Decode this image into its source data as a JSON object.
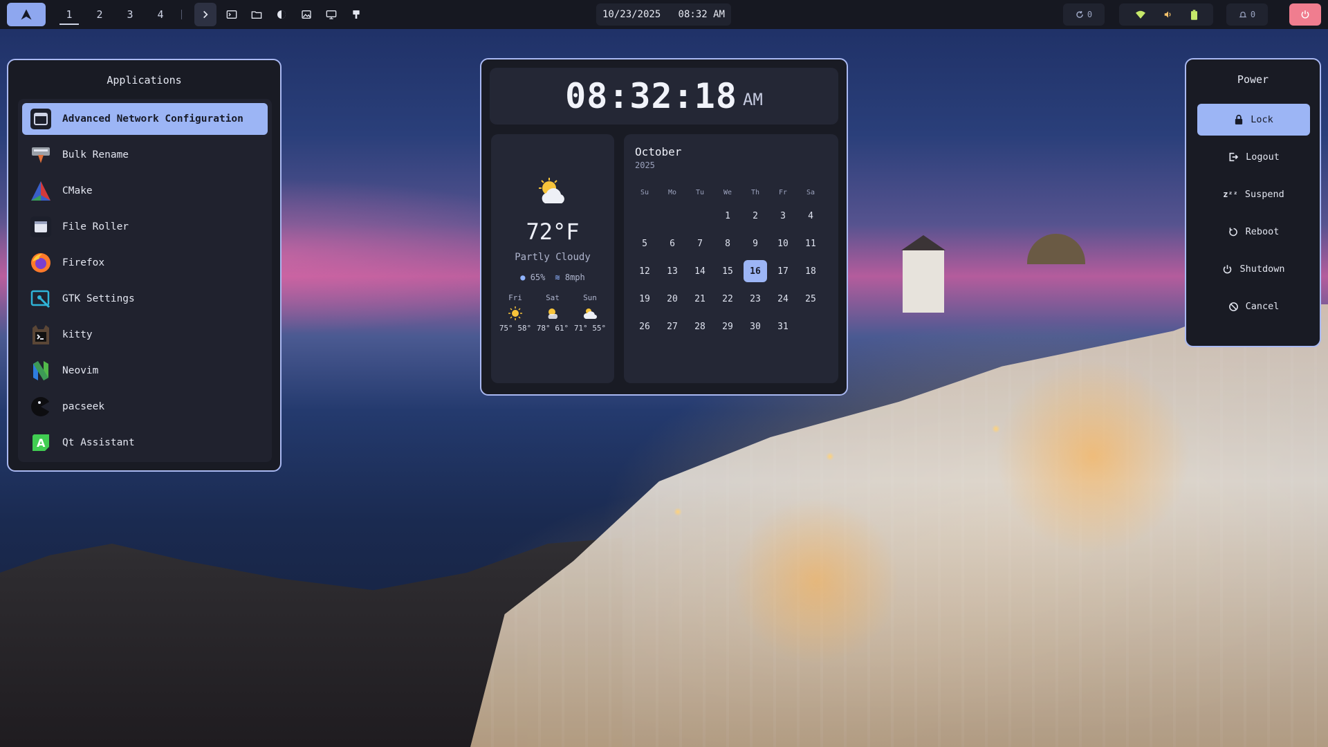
{
  "topbar": {
    "workspaces": [
      "1",
      "2",
      "3",
      "4"
    ],
    "active_workspace": "1",
    "datetime": "10/23/2025   08:32 AM",
    "updates_count": "0",
    "notifications_count": "0"
  },
  "applications": {
    "title": "Applications",
    "items": [
      {
        "label": "Advanced Network Configuration",
        "icon": "network-config-icon"
      },
      {
        "label": "Bulk Rename",
        "icon": "bulk-rename-icon"
      },
      {
        "label": "CMake",
        "icon": "cmake-icon"
      },
      {
        "label": "File Roller",
        "icon": "file-roller-icon"
      },
      {
        "label": "Firefox",
        "icon": "firefox-icon"
      },
      {
        "label": "GTK Settings",
        "icon": "gtk-settings-icon"
      },
      {
        "label": "kitty",
        "icon": "kitty-icon"
      },
      {
        "label": "Neovim",
        "icon": "neovim-icon"
      },
      {
        "label": "pacseek",
        "icon": "pacseek-icon"
      },
      {
        "label": "Qt Assistant",
        "icon": "qt-assistant-icon"
      }
    ]
  },
  "clock": {
    "time": "08:32:18",
    "ampm": "AM"
  },
  "weather": {
    "temperature": "72°F",
    "condition": "Partly Cloudy",
    "humidity": "65%",
    "wind": "8mph",
    "forecast": [
      {
        "day": "Fri",
        "high": "75°",
        "low": "58°",
        "icon": "sun-icon"
      },
      {
        "day": "Sat",
        "high": "78°",
        "low": "61°",
        "icon": "sun-cloud-icon"
      },
      {
        "day": "Sun",
        "high": "71°",
        "low": "55°",
        "icon": "partly-cloudy-icon"
      }
    ]
  },
  "calendar": {
    "month": "October",
    "year": "2025",
    "weekdays": [
      "Su",
      "Mo",
      "Tu",
      "We",
      "Th",
      "Fr",
      "Sa"
    ],
    "today": "16",
    "days": [
      "",
      "",
      "",
      "1",
      "2",
      "3",
      "4",
      "5",
      "6",
      "7",
      "8",
      "9",
      "10",
      "11",
      "12",
      "13",
      "14",
      "15",
      "16",
      "17",
      "18",
      "19",
      "20",
      "21",
      "22",
      "23",
      "24",
      "25",
      "26",
      "27",
      "28",
      "29",
      "30",
      "31",
      ""
    ]
  },
  "power": {
    "title": "Power",
    "items": [
      {
        "label": "Lock",
        "icon": "lock-icon"
      },
      {
        "label": "Logout",
        "icon": "logout-icon"
      },
      {
        "label": "Suspend",
        "icon": "sleep-icon"
      },
      {
        "label": "Reboot",
        "icon": "reboot-icon"
      },
      {
        "label": "Shutdown",
        "icon": "power-icon"
      },
      {
        "label": "Cancel",
        "icon": "cancel-icon"
      }
    ]
  },
  "colors": {
    "accent": "#9cb5f5",
    "panel_bg": "#191b24",
    "panel_border": "#aab9f2",
    "power_button": "#f07d8f"
  }
}
